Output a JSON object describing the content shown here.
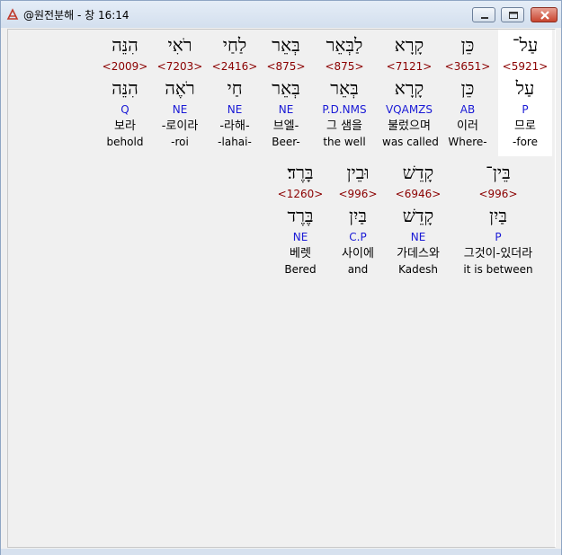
{
  "window": {
    "title": "@원전분해 - 창 16:14"
  },
  "verse_rows": [
    {
      "words": [
        {
          "heb": "עַל־",
          "strong": "<5921>",
          "lemma": "עַל",
          "morph": "P",
          "kor": "므로",
          "eng": "-fore",
          "selected": true
        },
        {
          "heb": "כֵּן",
          "strong": "<3651>",
          "lemma": "כֵּן",
          "morph": "AB",
          "kor": "이러",
          "eng": "Where-"
        },
        {
          "heb": "קָרָא",
          "strong": "<7121>",
          "lemma": "קָרָא",
          "morph": "VQAMZS",
          "kor": "불렀으며",
          "eng": "was called"
        },
        {
          "heb": "לַבְּאֵר",
          "strong": "<875>",
          "lemma": "בְּאֵר",
          "morph": "P.D.NMS",
          "kor": "그 샘을",
          "eng": "the well"
        },
        {
          "heb": "בְּאֵר",
          "strong": "<875>",
          "lemma": "בְּאֵר",
          "morph": "NE",
          "kor": "브엘-",
          "eng": "Beer-"
        },
        {
          "heb": "לַחַי",
          "strong": "<2416>",
          "lemma": "חַי",
          "morph": "NE",
          "kor": "-라해-",
          "eng": "-lahai-"
        },
        {
          "heb": "רֹאִי",
          "strong": "<7203>",
          "lemma": "רֹאֶה",
          "morph": "NE",
          "kor": "-로이라",
          "eng": "-roi"
        },
        {
          "heb": "הִנֵּה",
          "strong": "<2009>",
          "lemma": "הִנֵּה",
          "morph": "Q",
          "kor": "보라",
          "eng": "behold"
        }
      ]
    },
    {
      "words": [
        {
          "heb": "בֵּין־",
          "strong": "<996>",
          "lemma": "בַּיִן",
          "morph": "P",
          "kor": "그것이-있더라",
          "eng": "it is between"
        },
        {
          "heb": "קָדֵשׁ",
          "strong": "<6946>",
          "lemma": "קָדֵשׁ",
          "morph": "NE",
          "kor": "가데스와",
          "eng": "Kadesh"
        },
        {
          "heb": "וּבֵין",
          "strong": "<996>",
          "lemma": "בַּיִן",
          "morph": "C.P",
          "kor": "사이에",
          "eng": "and"
        },
        {
          "heb": "בָּרֶד׃",
          "strong": "<1260>",
          "lemma": "בֶּרֶד",
          "morph": "NE",
          "kor": "베렛",
          "eng": "Bered"
        }
      ]
    }
  ],
  "colors": {
    "strong": "#8b0000",
    "morph": "#1a1ad6",
    "selected_bg": "#ffffff"
  }
}
